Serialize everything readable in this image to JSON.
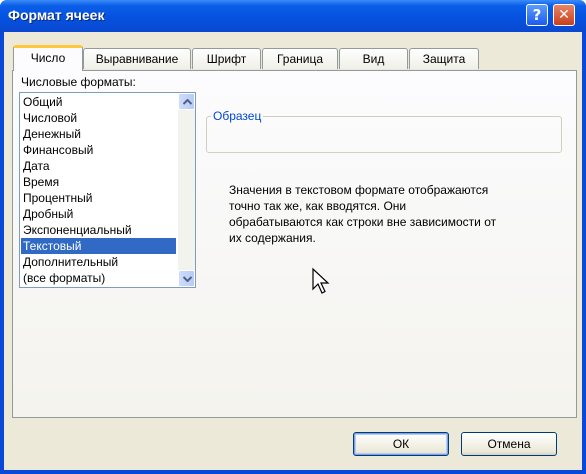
{
  "window": {
    "title": "Формат ячеек",
    "help_button": "?",
    "close_button": "✕"
  },
  "tabs": [
    {
      "label": "Число",
      "active": true
    },
    {
      "label": "Выравнивание",
      "active": false
    },
    {
      "label": "Шрифт",
      "active": false
    },
    {
      "label": "Граница",
      "active": false
    },
    {
      "label": "Вид",
      "active": false
    },
    {
      "label": "Защита",
      "active": false
    }
  ],
  "formats": {
    "label": "Числовые форматы:",
    "items": [
      "Общий",
      "Числовой",
      "Денежный",
      "Финансовый",
      "Дата",
      "Время",
      "Процентный",
      "Дробный",
      "Экспоненциальный",
      "Текстовый",
      "Дополнительный",
      "(все форматы)"
    ],
    "selected": "Текстовый"
  },
  "sample": {
    "label": "Образец",
    "value": ""
  },
  "description": {
    "lines": [
      "Значения в текстовом формате отображаются",
      "точно так же, как вводятся. Они",
      "обрабатываются как строки вне зависимости от",
      "их содержания."
    ]
  },
  "buttons": {
    "ok": "ОК",
    "cancel": "Отмена"
  },
  "colors": {
    "title_bar": "#0552e0",
    "active_tab_accent": "#ffc83c",
    "selection": "#316ac5",
    "dialog_face": "#ece9d8"
  }
}
